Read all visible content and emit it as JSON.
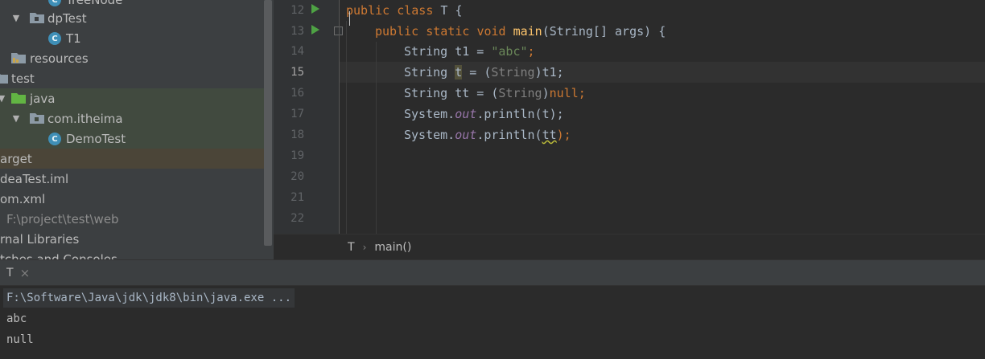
{
  "tree": {
    "items": [
      {
        "label": "TreeNode",
        "icon": "class-icon"
      },
      {
        "label": "dpTest",
        "icon": "package-icon"
      },
      {
        "label": "T1",
        "icon": "class-icon"
      },
      {
        "label": "resources",
        "icon": "folder-icon"
      },
      {
        "label": "test",
        "icon": "folder-icon"
      },
      {
        "label": "java",
        "icon": "folder-icon"
      },
      {
        "label": "com.itheima",
        "icon": "package-icon"
      },
      {
        "label": "DemoTest",
        "icon": "class-icon"
      },
      {
        "label": "arget",
        "icon": ""
      },
      {
        "label": "deaTest.iml",
        "icon": ""
      },
      {
        "label": "om.xml",
        "icon": ""
      },
      {
        "label": "F:\\project\\test\\web",
        "icon": ""
      },
      {
        "label": "rnal Libraries",
        "icon": ""
      },
      {
        "label": "tches and Consoles",
        "icon": ""
      }
    ],
    "class_glyph": "C"
  },
  "editor": {
    "line_numbers": [
      "12",
      "13",
      "14",
      "15",
      "16",
      "17",
      "18",
      "19",
      "20",
      "21",
      "22"
    ],
    "lines": {
      "l12": {
        "kw1": "public",
        "kw2": "class",
        "name": "T",
        "brace": " {"
      },
      "l13": {
        "kw1": "public",
        "kw2": "static",
        "kw3": "void",
        "fn": "main",
        "rest": "(String[] args) {"
      },
      "l14": {
        "type": "String t1 = ",
        "str": "\"abc\"",
        "end": ";"
      },
      "l15": {
        "type": "String ",
        "var": "t",
        "mid": " = (",
        "cast": "String",
        "rest": ")t1;"
      },
      "l16": {
        "type": "String tt = (",
        "cast": "String",
        "close": ")",
        "kw": "null",
        "end": ";"
      },
      "l17": {
        "pre": "System.",
        "out": "out",
        "call": ".println(t);"
      },
      "l18": {
        "pre": "System.",
        "out": "out",
        "call": ".println(",
        "arg": "tt",
        "end": ");"
      }
    }
  },
  "breadcrumb": {
    "items": [
      "T",
      "main()"
    ],
    "separator": "›"
  },
  "run": {
    "tab_label": "T",
    "close_glyph": "×",
    "console": [
      "F:\\Software\\Java\\jdk\\jdk8\\bin\\java.exe ...",
      "abc",
      "null"
    ]
  },
  "colors": {
    "keyword": "#cc7832",
    "string": "#6a8759",
    "function": "#ffc66d",
    "field": "#9876aa",
    "run_icon": "#4ea244",
    "class_icon": "#3f8fb7"
  }
}
